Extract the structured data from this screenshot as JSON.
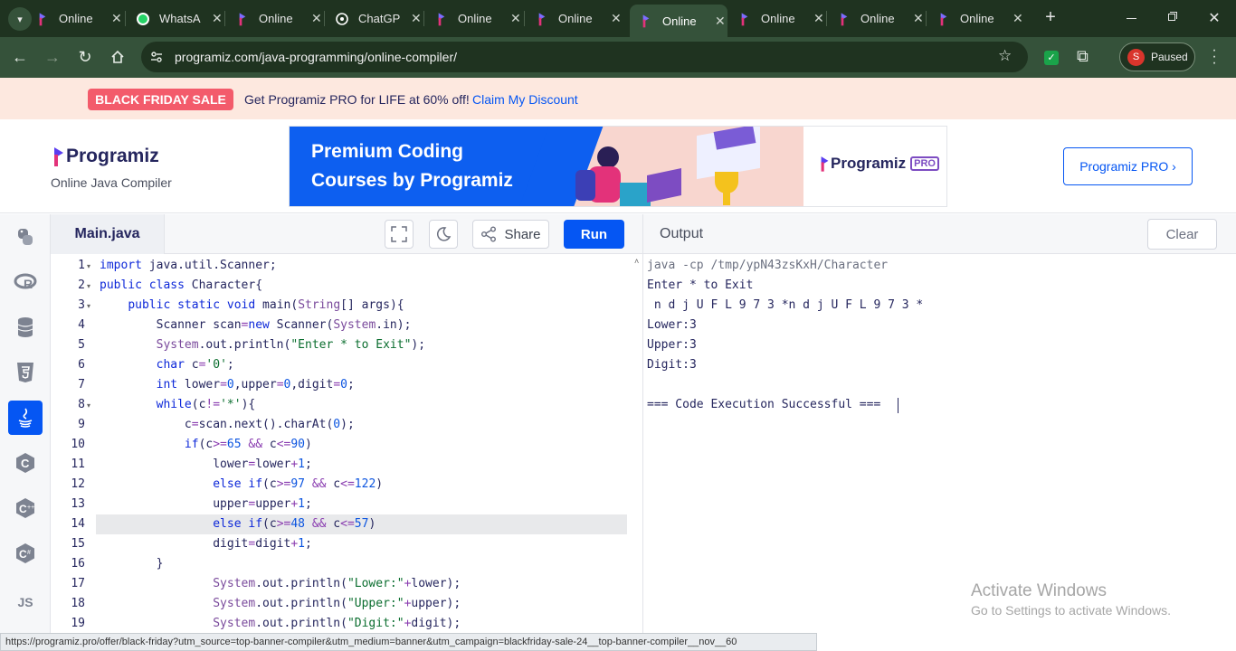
{
  "browser": {
    "tabs": [
      {
        "title": "Online",
        "icon": "programiz-icon"
      },
      {
        "title": "WhatsA",
        "icon": "whatsapp-icon"
      },
      {
        "title": "Online",
        "icon": "programiz-icon"
      },
      {
        "title": "ChatGP",
        "icon": "chatgpt-icon"
      },
      {
        "title": "Online",
        "icon": "programiz-icon"
      },
      {
        "title": "Online",
        "icon": "programiz-icon"
      },
      {
        "title": "Online",
        "icon": "programiz-icon",
        "active": true
      },
      {
        "title": "Online",
        "icon": "programiz-icon"
      },
      {
        "title": "Online",
        "icon": "programiz-icon"
      },
      {
        "title": "Online",
        "icon": "programiz-icon"
      }
    ],
    "url": "programiz.com/java-programming/online-compiler/",
    "profile_initial": "S",
    "profile_status": "Paused",
    "status_url": "https://programiz.pro/offer/black-friday?utm_source=top-banner-compiler&utm_medium=banner&utm_campaign=blackfriday-sale-24__top-banner-compiler__nov__60"
  },
  "promo": {
    "badge": "BLACK FRIDAY SALE",
    "text": "Get Programiz PRO for LIFE at 60% off!",
    "link": "Claim My Discount"
  },
  "header": {
    "logo": "Programiz",
    "subtitle": "Online Java Compiler",
    "ad_line1": "Premium Coding",
    "ad_line2": "Courses by Programiz",
    "ad_logo": "Programiz",
    "ad_pro": "PRO",
    "pro_button": "Programiz PRO ›"
  },
  "sidebar": {
    "languages": [
      "python",
      "r",
      "sql",
      "html",
      "java",
      "c",
      "cpp",
      "csharp",
      "js"
    ],
    "active": "java",
    "js_label": "JS"
  },
  "editor": {
    "file_tab": "Main.java",
    "share_label": "Share",
    "run_label": "Run",
    "current_line": 14,
    "lines": [
      "import java.util.Scanner;",
      "public class Character{",
      "    public static void main(String[] args){",
      "        Scanner scan=new Scanner(System.in);",
      "        System.out.println(\"Enter * to Exit\");",
      "        char c='0';",
      "        int lower=0,upper=0,digit=0;",
      "        while(c!='*'){",
      "            c=scan.next().charAt(0);",
      "            if(c>=65 && c<=90)",
      "                lower=lower+1;",
      "                else if(c>=97 && c<=122)",
      "                upper=upper+1;",
      "                else if(c>=48 && c<=57)",
      "                digit=digit+1;",
      "        }",
      "                System.out.println(\"Lower:\"+lower);",
      "                System.out.println(\"Upper:\"+upper);",
      "                System.out.println(\"Digit:\"+digit);"
    ]
  },
  "output": {
    "title": "Output",
    "clear_label": "Clear",
    "lines": [
      "java -cp /tmp/ypN43zsKxH/Character",
      "Enter * to Exit",
      " n d j U F L 9 7 3 *n d j U F L 9 7 3 *",
      "Lower:3",
      "Upper:3",
      "Digit:3",
      "",
      "=== Code Execution Successful ==="
    ]
  },
  "watermark": {
    "title": "Activate Windows",
    "subtitle": "Go to Settings to activate Windows."
  },
  "colors": {
    "accent": "#0556f3",
    "sale": "#f35b6b",
    "promo_bg": "#fde8df",
    "browser_frame": "#1f3320",
    "text_dark": "#25265e"
  }
}
